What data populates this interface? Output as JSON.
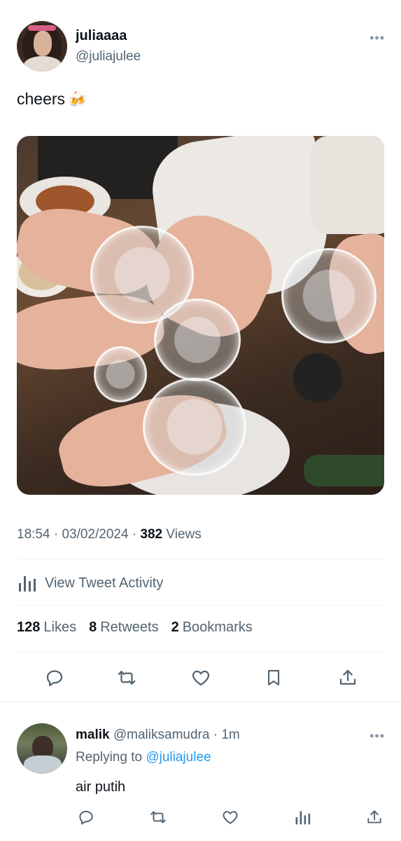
{
  "tweet": {
    "display_name": "juliaaaa",
    "handle": "@juliajulee",
    "more_icon": "more-horizontal-icon",
    "text": "cheers",
    "emoji": "🍻",
    "image_description": "photo of hands clinking shot glasses over a table",
    "time": "18:54",
    "date": "03/02/2024",
    "views_count": "382",
    "views_label": "Views",
    "meta_sep": "·"
  },
  "activity": {
    "label": "View Tweet Activity",
    "icon": "analytics-icon"
  },
  "stats": {
    "likes_count": "128",
    "likes_label": "Likes",
    "retweets_count": "8",
    "retweets_label": "Retweets",
    "bookmarks_count": "2",
    "bookmarks_label": "Bookmarks"
  },
  "actions": [
    {
      "name": "reply",
      "icon": "reply-icon"
    },
    {
      "name": "retweet",
      "icon": "retweet-icon"
    },
    {
      "name": "like",
      "icon": "heart-icon"
    },
    {
      "name": "bookmark",
      "icon": "bookmark-icon"
    },
    {
      "name": "share",
      "icon": "share-icon"
    }
  ],
  "reply": {
    "display_name": "malik",
    "handle": "@maliksamudra",
    "time": "1m",
    "sep": "·",
    "replying_prefix": "Replying to",
    "replying_to": "@juliajulee",
    "text": "air putih",
    "actions": [
      "reply-icon",
      "retweet-icon",
      "heart-icon",
      "analytics-icon",
      "share-icon"
    ]
  },
  "colors": {
    "text": "#0f1419",
    "secondary": "#536471",
    "link": "#1d9bf0",
    "divider": "#eff3f4"
  }
}
